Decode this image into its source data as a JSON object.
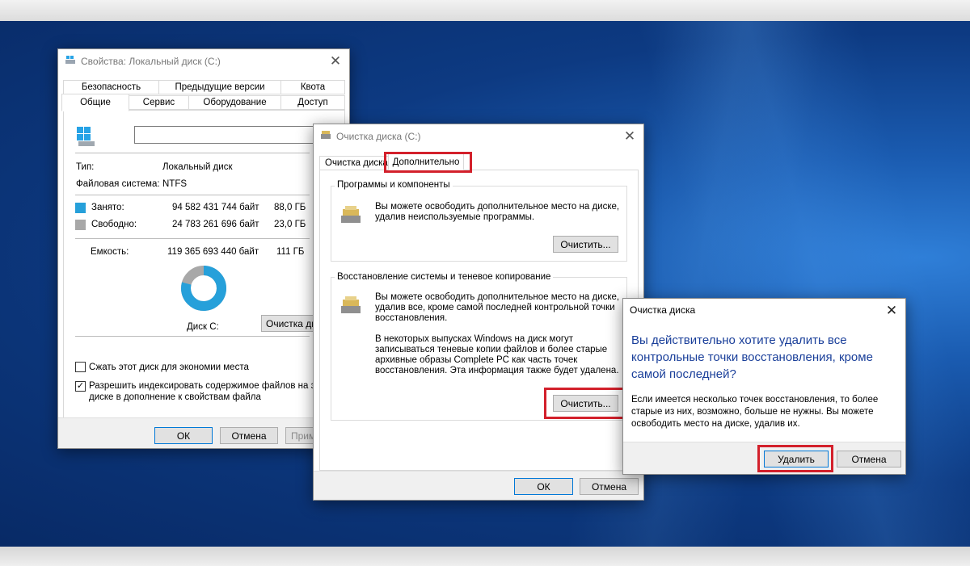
{
  "props_window": {
    "title": "Свойства: Локальный диск (C:)",
    "tabs_row1": [
      "Безопасность",
      "Предыдущие версии",
      "Квота"
    ],
    "tabs_row2": [
      "Общие",
      "Сервис",
      "Оборудование",
      "Доступ"
    ],
    "name_value": "",
    "type_label": "Тип:",
    "type_value": "Локальный диск",
    "fs_label": "Файловая система:",
    "fs_value": "NTFS",
    "used_label": "Занято:",
    "used_bytes": "94 582 431 744 байт",
    "used_gb": "88,0 ГБ",
    "free_label": "Свободно:",
    "free_bytes": "24 783 261 696 байт",
    "free_gb": "23,0 ГБ",
    "capacity_label": "Емкость:",
    "capacity_bytes": "119 365 693 440 байт",
    "capacity_gb": "111 ГБ",
    "disk_label": "Диск C:",
    "cleanup_button": "Очистка дис",
    "compress_label": "Сжать этот диск для экономии места",
    "index_label_line1": "Разрешить индексировать содержимое файлов на это",
    "index_label_line2": "диске в дополнение к свойствам файла",
    "index_checked": "✓",
    "ok": "ОК",
    "cancel": "Отмена",
    "apply": "Прим",
    "colors": {
      "used": "#26a0da",
      "free": "#a8a8a8"
    },
    "used_fraction": 0.7924
  },
  "cleanup_window": {
    "title": "Очистка диска  (C:)",
    "tab1": "Очистка диска",
    "tab2": "Дополнительно",
    "group1_title": "Программы и компоненты",
    "group1_text1": "Вы можете освободить дополнительное место на диске,",
    "group1_text2": "удалив неиспользуемые программы.",
    "group1_button": "Очистить...",
    "group2_title": "Восстановление системы и теневое копирование",
    "group2_text1": "Вы можете освободить дополнительное место на диске,",
    "group2_text2": "удалив все, кроме самой последней контрольной точки",
    "group2_text3": "восстановления.",
    "group2_text4": "В некоторых выпусках Windows на диск могут",
    "group2_text5": "записываться теневые копии файлов и более старые",
    "group2_text6": "архивные образы Complete PC как часть точек",
    "group2_text7": "восстановления. Эта информация также будет удалена.",
    "group2_button": "Очистить...",
    "ok": "ОК",
    "cancel": "Отмена"
  },
  "confirm_dialog": {
    "title": "Очистка диска",
    "question1": "Вы действительно хотите удалить все",
    "question2": "контрольные точки восстановления, кроме",
    "question3": "самой последней?",
    "info1": "Если имеется несколько точек восстановления, то более",
    "info2": "старые из них, возможно, больше не нужны. Вы можете",
    "info3": "освободить место на диске, удалив их.",
    "delete_button": "Удалить",
    "cancel_button": "Отмена",
    "question_color": "#1a3f9a"
  }
}
